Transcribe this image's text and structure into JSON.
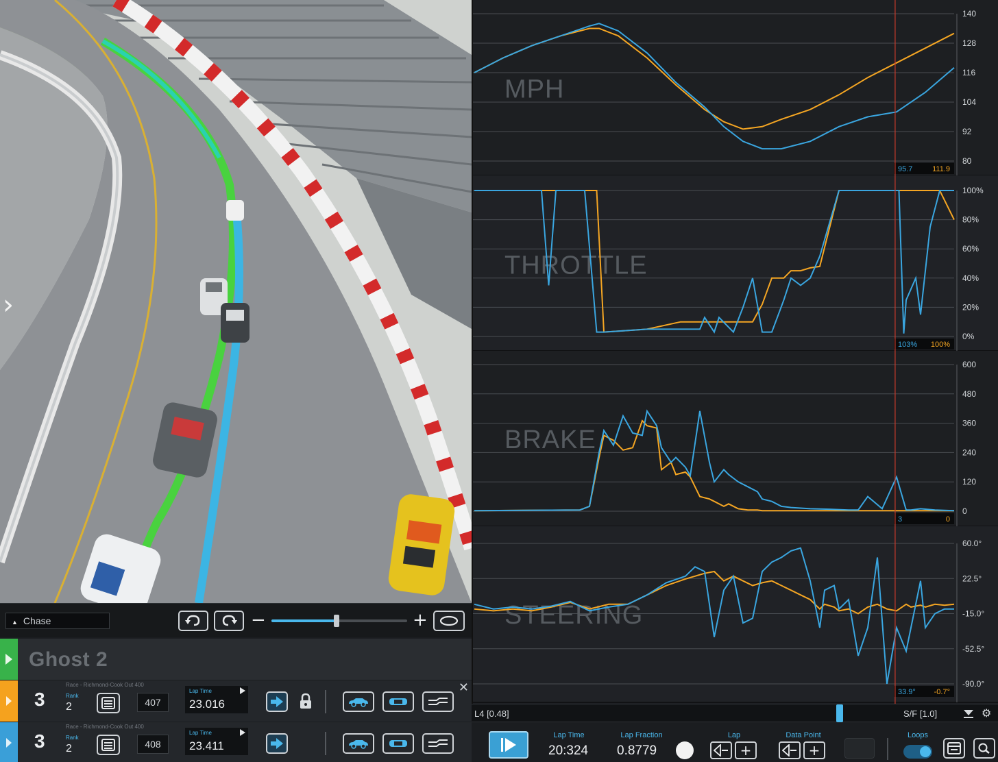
{
  "camera": {
    "mode_label": "Chase",
    "zoom_level": 0.48
  },
  "ghost_header": {
    "title": "Ghost 2",
    "color": "#38b24a"
  },
  "laps": [
    {
      "session": "Race - Richmond-Cook Out 400",
      "lap": "3",
      "rank_label": "Rank",
      "rank": "2",
      "id": "407",
      "lap_time_label": "Lap Time",
      "lap_time": "23.016",
      "color": "#f5a21e",
      "locked": true
    },
    {
      "session": "Race - Richmond-Cook Out 400",
      "lap": "3",
      "rank_label": "Rank",
      "rank": "2",
      "id": "408",
      "lap_time_label": "Lap Time",
      "lap_time": "23.411",
      "color": "#3a9fd8",
      "locked": false
    }
  ],
  "charts": [
    {
      "title": "MPH",
      "ticks": [
        "140",
        "128",
        "116",
        "104",
        "92",
        "80"
      ],
      "ymin": 80,
      "ymax": 140,
      "readout_blue": "95.7",
      "readout_orange": "111.9"
    },
    {
      "title": "THROTTLE",
      "ticks": [
        "100%",
        "80%",
        "60%",
        "40%",
        "20%",
        "0%"
      ],
      "ymin": 0,
      "ymax": 100,
      "readout_blue": "103%",
      "readout_orange": "100%"
    },
    {
      "title": "BRAKE",
      "ticks": [
        "600",
        "480",
        "360",
        "240",
        "120",
        "0"
      ],
      "ymin": 0,
      "ymax": 600,
      "readout_blue": "3",
      "readout_orange": "0"
    },
    {
      "title": "STEERING",
      "ticks": [
        "60.0°",
        "22.5°",
        "-15.0°",
        "-52.5°",
        "-90.0°"
      ],
      "ymin": -90,
      "ymax": 60,
      "readout_blue": "33.9°",
      "readout_orange": "-0.7°"
    }
  ],
  "chart_data": {
    "type": "line",
    "x_label": "lap fraction",
    "cursor_x": 0.877,
    "series_colors": {
      "blue": "#3aa6e0",
      "orange": "#f5a623"
    },
    "mph": {
      "x": [
        0.0,
        0.06,
        0.12,
        0.18,
        0.24,
        0.26,
        0.3,
        0.36,
        0.42,
        0.48,
        0.52,
        0.56,
        0.6,
        0.64,
        0.7,
        0.76,
        0.82,
        0.88,
        0.94,
        1.0
      ],
      "blue": [
        116,
        122,
        127,
        131,
        135,
        136,
        133,
        124,
        112,
        102,
        94,
        88,
        85,
        85,
        88,
        94,
        98,
        100,
        108,
        118
      ],
      "orange": [
        116,
        122,
        127,
        131,
        134,
        134,
        131,
        122,
        111,
        101,
        96,
        93,
        94,
        97,
        101,
        107,
        114,
        120,
        126,
        132
      ]
    },
    "throttle": {
      "x": [
        0.0,
        0.14,
        0.155,
        0.17,
        0.18,
        0.23,
        0.255,
        0.27,
        0.36,
        0.43,
        0.47,
        0.48,
        0.5,
        0.51,
        0.54,
        0.56,
        0.58,
        0.6,
        0.62,
        0.645,
        0.66,
        0.68,
        0.7,
        0.72,
        0.76,
        0.84,
        0.885,
        0.895,
        0.9,
        0.92,
        0.93,
        0.95,
        0.97,
        1.0
      ],
      "blue": [
        100,
        100,
        35,
        100,
        100,
        100,
        3,
        3,
        5,
        5,
        5,
        13,
        3,
        13,
        3,
        20,
        40,
        3,
        3,
        25,
        40,
        35,
        40,
        55,
        100,
        100,
        100,
        2,
        25,
        40,
        15,
        75,
        100,
        100
      ],
      "orange": [
        100,
        100,
        100,
        100,
        100,
        100,
        100,
        3,
        5,
        10,
        10,
        10,
        10,
        10,
        10,
        10,
        10,
        22,
        40,
        40,
        45,
        45,
        47,
        48,
        100,
        100,
        100,
        100,
        100,
        100,
        100,
        100,
        100,
        80
      ]
    },
    "brake": {
      "x": [
        0.0,
        0.22,
        0.24,
        0.26,
        0.27,
        0.29,
        0.31,
        0.33,
        0.35,
        0.36,
        0.38,
        0.39,
        0.41,
        0.42,
        0.44,
        0.45,
        0.47,
        0.49,
        0.5,
        0.52,
        0.53,
        0.55,
        0.57,
        0.59,
        0.6,
        0.62,
        0.64,
        0.66,
        0.7,
        0.74,
        0.78,
        0.8,
        0.82,
        0.85,
        0.88,
        0.9,
        0.91,
        0.93,
        0.96,
        1.0
      ],
      "blue": [
        2,
        5,
        20,
        240,
        330,
        270,
        390,
        320,
        310,
        410,
        350,
        260,
        200,
        220,
        180,
        145,
        410,
        200,
        120,
        170,
        150,
        120,
        100,
        80,
        50,
        40,
        20,
        15,
        10,
        8,
        5,
        5,
        60,
        10,
        140,
        5,
        5,
        10,
        5,
        2
      ],
      "orange": [
        2,
        5,
        20,
        220,
        310,
        290,
        250,
        260,
        370,
        350,
        340,
        170,
        200,
        150,
        160,
        140,
        60,
        50,
        40,
        20,
        30,
        10,
        5,
        5,
        2,
        2,
        2,
        2,
        2,
        2,
        2,
        2,
        2,
        2,
        2,
        2,
        2,
        2,
        2,
        2
      ]
    },
    "steering": {
      "x": [
        0.0,
        0.04,
        0.08,
        0.12,
        0.16,
        0.2,
        0.24,
        0.28,
        0.32,
        0.36,
        0.4,
        0.44,
        0.46,
        0.48,
        0.5,
        0.52,
        0.54,
        0.56,
        0.58,
        0.6,
        0.62,
        0.64,
        0.66,
        0.68,
        0.7,
        0.72,
        0.73,
        0.75,
        0.76,
        0.78,
        0.8,
        0.82,
        0.84,
        0.86,
        0.88,
        0.9,
        0.91,
        0.93,
        0.94,
        0.96,
        0.98,
        1.0
      ],
      "blue": [
        -5,
        -10,
        -8,
        -10,
        -7,
        -2,
        -12,
        -8,
        -5,
        5,
        18,
        25,
        35,
        30,
        -40,
        10,
        25,
        -25,
        -20,
        30,
        40,
        45,
        52,
        55,
        20,
        -30,
        10,
        15,
        -10,
        0,
        -60,
        -30,
        45,
        -90,
        -30,
        -55,
        -30,
        20,
        -30,
        -15,
        -10,
        -10
      ],
      "orange": [
        -10,
        -12,
        -10,
        -12,
        -8,
        -3,
        -10,
        -5,
        -5,
        5,
        15,
        22,
        25,
        28,
        30,
        20,
        25,
        20,
        15,
        18,
        20,
        15,
        10,
        5,
        0,
        -10,
        -5,
        -8,
        -12,
        -10,
        -15,
        -8,
        -5,
        -10,
        -12,
        -5,
        -8,
        -6,
        -8,
        -5,
        -6,
        -5
      ]
    }
  },
  "scrubber": {
    "left_label": "L4 [0.48]",
    "right_label": "S/F [1.0]",
    "position": 0.693
  },
  "playback": {
    "lap_time_label": "Lap Time",
    "lap_time": "20:324",
    "lap_fraction_label": "Lap Fraction",
    "lap_fraction": "0.8779",
    "lap_label": "Lap",
    "data_point_label": "Data Point",
    "loops_label": "Loops",
    "loops_on": true
  }
}
